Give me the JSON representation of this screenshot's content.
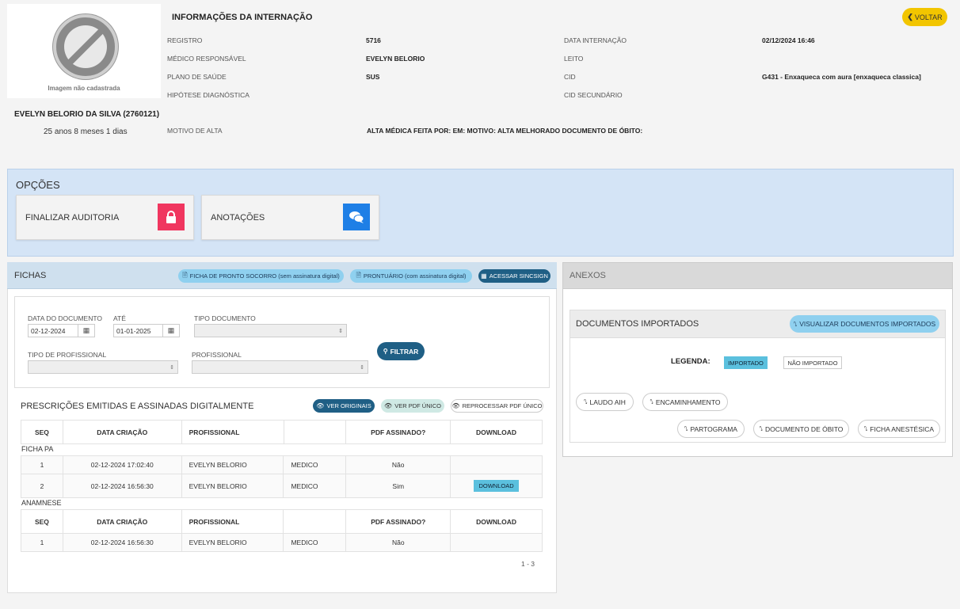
{
  "patient": {
    "photo_caption": "Imagem não cadastrada",
    "name": "EVELYN BELORIO DA SILVA (2760121)",
    "age": "25 anos 8 meses 1 dias"
  },
  "header": {
    "title": "INFORMAÇÕES DA INTERNAÇÃO",
    "back_label": "VOLTAR",
    "fields": {
      "registro_label": "REGISTRO",
      "registro_value": "5716",
      "medico_label": "MÉDICO RESPONSÁVEL",
      "medico_value": "EVELYN BELORIO",
      "plano_label": "PLANO DE SAÚDE",
      "plano_value": "SUS",
      "hipotese_label": "HIPÓTESE DIAGNÓSTICA",
      "data_label": "DATA INTERNAÇÃO",
      "data_value": "02/12/2024 16:46",
      "leito_label": "LEITO",
      "cid_label": "CID",
      "cid_value": "G431 - Enxaqueca com aura [enxaqueca classica]",
      "cid2_label": "CID SECUNDÁRIO",
      "motivo_label": "MOTIVO DE ALTA",
      "motivo_value": "ALTA MÉDICA FEITA POR: EM: MOTIVO: ALTA MELHORADO DOCUMENTO DE ÓBITO:"
    }
  },
  "opcoes": {
    "title": "OPÇÕES",
    "finalizar": "FINALIZAR AUDITORIA",
    "anotacoes": "ANOTAÇÕES",
    "finalizar_color": "#f0365f",
    "anotacoes_color": "#1e7fe6"
  },
  "fichas": {
    "title": "FICHAS",
    "btn_pronto_socorro": "FICHA DE PRONTO SOCORRO (sem assinatura digital)",
    "btn_prontuario": "PRONTUÁRIO (com assinatura digital)",
    "btn_sincsign": "ACESSAR SINCSIGN",
    "filters": {
      "data_doc_label": "DATA DO DOCUMENTO",
      "data_doc_value": "02-12-2024",
      "ate_label": "ATÉ",
      "ate_value": "01-01-2025",
      "tipo_doc_label": "TIPO DOCUMENTO",
      "tipo_prof_label": "TIPO DE PROFISSIONAL",
      "prof_label": "PROFISSIONAL",
      "filtrar": "FILTRAR"
    },
    "prescricoes_title": "PRESCRIÇÕES EMITIDAS E ASSINADAS DIGITALMENTE",
    "btn_ver_originais": "VER ORIGINAIS",
    "btn_ver_pdf": "VER PDF ÚNICO",
    "btn_reprocessar": "REPROCESSAR PDF ÚNICO",
    "columns": [
      "SEQ",
      "DATA CRIAÇÃO",
      "PROFISSIONAL",
      "",
      "PDF ASSINADO?",
      "DOWNLOAD"
    ],
    "group1": "FICHA PA",
    "rows1": [
      {
        "seq": "1",
        "data": "02-12-2024 17:02:40",
        "prof": "EVELYN BELORIO",
        "tipo": "MEDICO",
        "pdf": "Não",
        "download": ""
      },
      {
        "seq": "2",
        "data": "02-12-2024 16:56:30",
        "prof": "EVELYN BELORIO",
        "tipo": "MEDICO",
        "pdf": "Sim",
        "download": "DOWNLOAD"
      }
    ],
    "group2": "ANAMNESE",
    "rows2": [
      {
        "seq": "1",
        "data": "02-12-2024 16:56:30",
        "prof": "EVELYN BELORIO",
        "tipo": "MEDICO",
        "pdf": "Não",
        "download": ""
      }
    ],
    "pagination": "1 - 3"
  },
  "anexos": {
    "title": "ANEXOS",
    "docimp_title": "DOCUMENTOS IMPORTADOS",
    "btn_visualizar": "VISUALIZAR DOCUMENTOS IMPORTADOS",
    "legenda": "LEGENDA:",
    "importado": "IMPORTADO",
    "nao_importado": "NÃO IMPORTADO",
    "docs": [
      "LAUDO AIH",
      "ENCAMINHAMENTO",
      "PARTOGRAMA",
      "DOCUMENTO DE ÓBITO",
      "FICHA ANESTÉSICA"
    ]
  }
}
